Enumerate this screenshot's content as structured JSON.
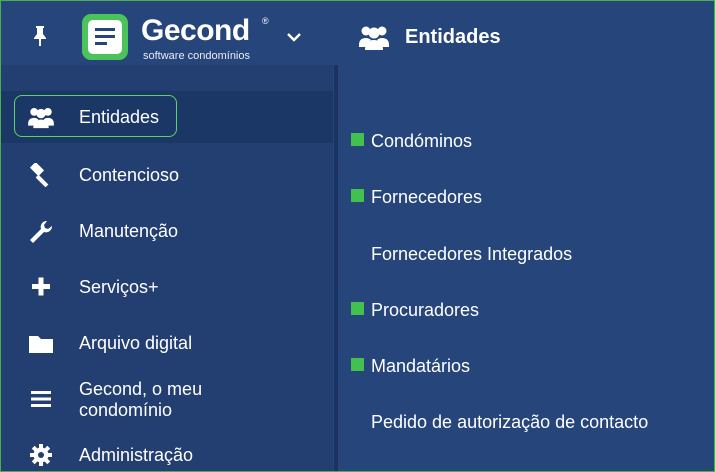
{
  "header": {
    "logo_name": "Gecond",
    "logo_registered": "®",
    "logo_tagline": "software condomínios",
    "section_title": "Entidades"
  },
  "sidebar": {
    "items": [
      {
        "label": "Entidades",
        "icon": "users-icon",
        "active": true
      },
      {
        "label": "Contencioso",
        "icon": "gavel-icon"
      },
      {
        "label": "Manutenção",
        "icon": "wrench-icon"
      },
      {
        "label": "Serviços+",
        "icon": "plus-icon"
      },
      {
        "label": "Arquivo digital",
        "icon": "folder-icon"
      },
      {
        "label": "Gecond, o meu condomínio",
        "icon": "menu-lines-icon"
      },
      {
        "label": "Administração",
        "icon": "gear-icon"
      }
    ]
  },
  "main": {
    "items": [
      {
        "label": "Condóminos",
        "marker": true
      },
      {
        "label": "Fornecedores",
        "marker": true
      },
      {
        "label": "Fornecedores Integrados",
        "marker": false
      },
      {
        "label": "Procuradores",
        "marker": true
      },
      {
        "label": "Mandatários",
        "marker": true
      },
      {
        "label": "Pedido de autorização de contacto",
        "marker": false
      }
    ]
  },
  "colors": {
    "background": "#26457a",
    "sidebar": "#233f71",
    "accent_green": "#43c14f",
    "text": "#ffffff"
  }
}
